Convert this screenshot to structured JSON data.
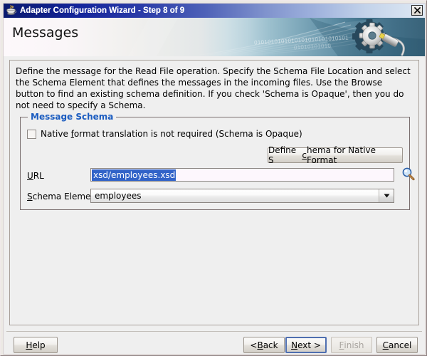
{
  "window": {
    "title": "Adapter Configuration Wizard - Step 8 of 9",
    "icon": "coffee-cup-icon",
    "close_label": "x"
  },
  "banner": {
    "heading": "Messages",
    "binary_text_1": "0101010101010101010101010101",
    "binary_text_2": "01010101010",
    "graphic": "gear-and-cable-icon"
  },
  "content": {
    "intro_line_1": "Define the message for the Read File operation.  Specify the Schema File Location and select the Schema Element",
    "intro_line_2": "that defines the messages in the incoming files. Use the Browse button to find an existing schema definition. If you",
    "intro_line_3": "check 'Schema is Opaque', then you do not need to specify a Schema."
  },
  "group": {
    "legend": "Message Schema",
    "checkbox": {
      "label_before": "Native ",
      "label_mnemonic": "f",
      "label_after": "ormat translation is not required (Schema is Opaque)",
      "checked": false
    },
    "define_schema_button": {
      "before": "Define S",
      "mnemonic": "c",
      "after": "hema for Native Format"
    },
    "url": {
      "label_mnemonic": "U",
      "label_after": "RL",
      "value": "xsd/employees.xsd",
      "selected": true,
      "browse_icon": "magnifier-icon"
    },
    "schema_element": {
      "label_mnemonic": "S",
      "label_after": "chema Element",
      "value": "employees",
      "options": [
        "employees"
      ]
    }
  },
  "footer": {
    "help": {
      "mnemonic": "H",
      "after": "elp"
    },
    "back": {
      "before": "< ",
      "mnemonic": "B",
      "after": "ack"
    },
    "next": {
      "mnemonic": "N",
      "after": "ext >",
      "focused": true
    },
    "finish": {
      "mnemonic": "F",
      "after": "inish",
      "enabled": false
    },
    "cancel": {
      "mnemonic": "C",
      "after": "ancel"
    }
  },
  "colors": {
    "accent_blue": "#1b5cc0",
    "selection_blue": "#3163c8",
    "titlebar_start": "#0a1a6e",
    "panel_bg": "#efefef",
    "disabled_text": "#a9a5a0"
  }
}
